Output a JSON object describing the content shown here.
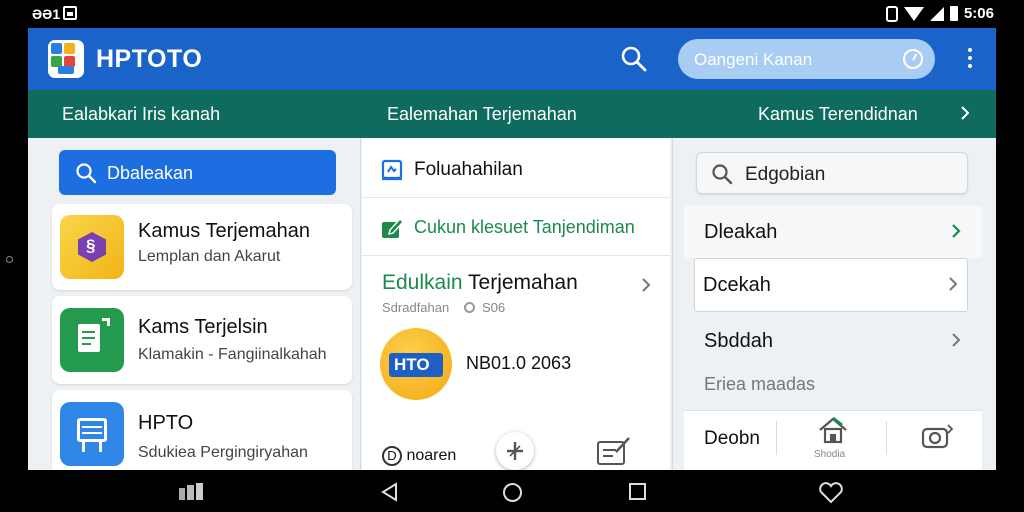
{
  "status_bar": {
    "left_text": "ƏƏ1",
    "right_time": "5:06"
  },
  "app_bar": {
    "title": "HPTOTO",
    "search_placeholder": "Oangeni Kanan"
  },
  "tabs": [
    {
      "label": "Ealabkari Iris kanah"
    },
    {
      "label": "Ealemahan  Terjemahan"
    },
    {
      "label": "Kamus Terendidnan"
    }
  ],
  "left_column": {
    "search_label": "Dbaleakan",
    "cards": [
      {
        "title": "Kamus Terjemahan",
        "subtitle": "Lemplan dan Akarut",
        "icon": "translate-app-icon",
        "icon_glyph": "§"
      },
      {
        "title": "Kams Terjelsin",
        "subtitle": "Klamakin - Fangiinalkahah",
        "icon": "document-app-icon"
      },
      {
        "title": "HPTO",
        "subtitle": "Sdukiea Pergingiryahan",
        "icon": "printer-app-icon"
      }
    ]
  },
  "middle_column": {
    "row1": "Foluahahilan",
    "row2": "Cukun klesuet Tanjendiman",
    "section_title_green": "Edulkain",
    "section_title_black": "Terjemahan",
    "section_meta": "Sdradfahan",
    "section_meta_count": "S06",
    "badge_text": "HTO",
    "code_text": "NB01.0 2063",
    "footer_label": "noaren",
    "footer_label_prefix": "D"
  },
  "right_column": {
    "search_label": "Edgobian",
    "items": [
      {
        "label": "Dleakah"
      },
      {
        "label": "Dcekah"
      },
      {
        "label": "Sbddah"
      }
    ],
    "faded_label": "Eriea maadas",
    "footer_label": "Deobn",
    "footer_home_caption": "Shodia"
  },
  "colors": {
    "app_bar": "#1a63c9",
    "tab_bar": "#0f6b5e",
    "accent_blue": "#1d6ee0",
    "accent_green": "#1b8a4c",
    "badge_yellow": "#f6b820"
  }
}
